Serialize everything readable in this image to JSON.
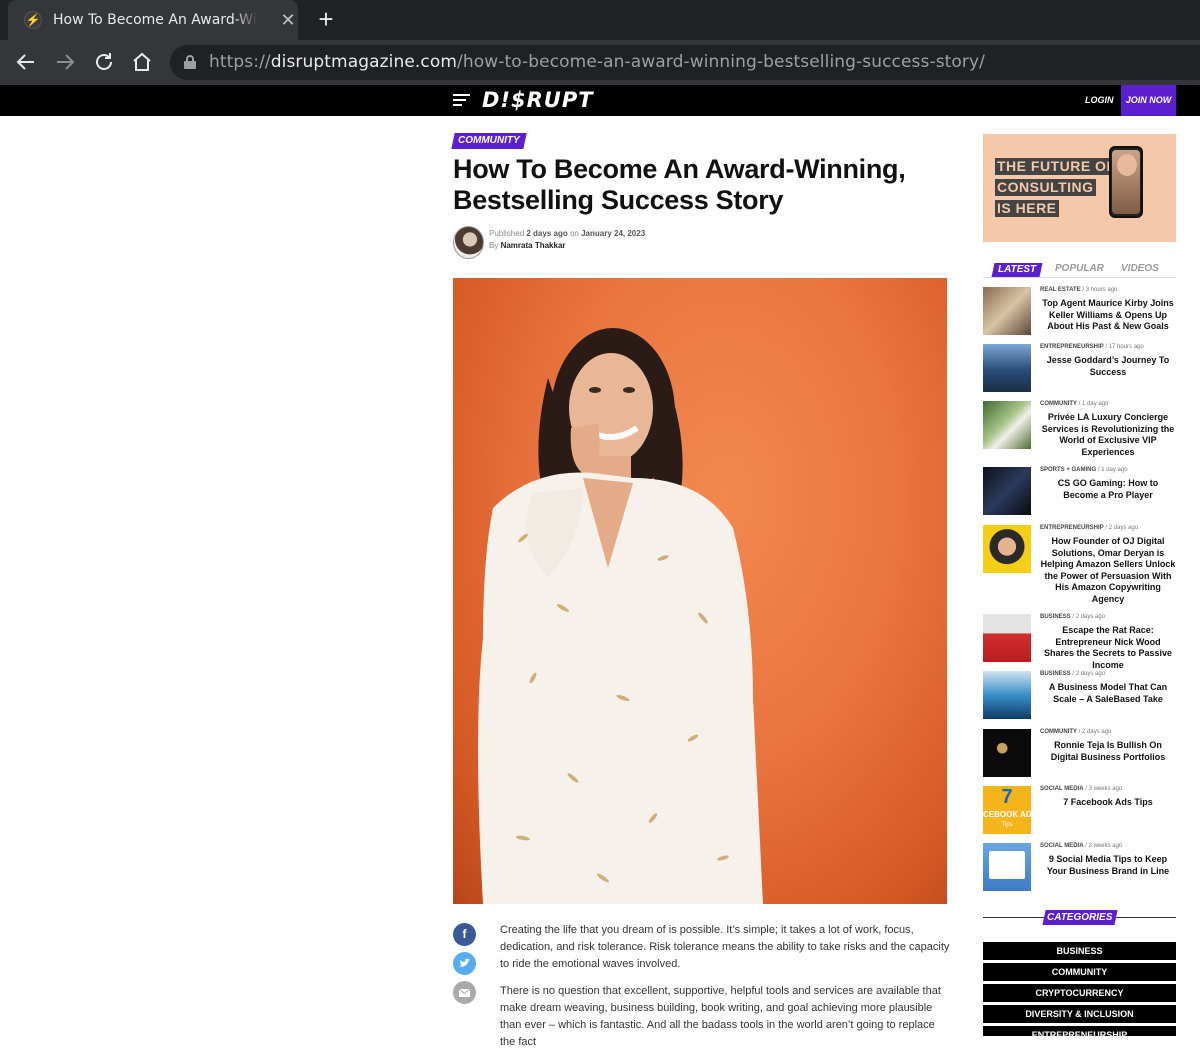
{
  "browser": {
    "tab_title": "How To Become An Award-Winning, Bestselling Success Story",
    "url_scheme": "https://",
    "url_host": "disruptmagazine.com",
    "url_path": "/how-to-become-an-award-winning-bestselling-success-story/"
  },
  "site": {
    "logo": "D!$RUPT",
    "login": "LOGIN",
    "join": "JOIN NOW"
  },
  "article": {
    "category": "COMMUNITY",
    "title_line1": "How To Become An Award-Winning,",
    "title_line2": "Bestselling Success Story",
    "published_label": "Published",
    "published_ago": "2 days ago",
    "published_on": "on",
    "published_date": "January 24, 2023",
    "by_label": "By",
    "author": "Namrata Thakkar",
    "para1": "Creating the life that you dream of is possible. It’s simple; it takes a lot of work, focus, dedication, and risk tolerance. Risk tolerance means the ability to take risks and the capacity to ride the emotional waves involved.",
    "para2": "There is no question that excellent, supportive, helpful tools and services are available that make dream weaving, business building, book writing, and goal achieving more plausible than ever – which is fantastic. And all the badass tools in the world aren’t going to replace the fact"
  },
  "ad": {
    "line1": "THE FUTURE OF",
    "line2": "CONSULTING",
    "line3": "IS HERE"
  },
  "sidebar": {
    "tabs": [
      "LATEST",
      "POPULAR",
      "VIDEOS"
    ],
    "feed": [
      {
        "category": "REAL ESTATE",
        "time": "3 hours ago",
        "title": "Top Agent Maurice Kirby Joins Keller Williams & Opens Up About His Past & New Goals"
      },
      {
        "category": "ENTREPRENEURSHIP",
        "time": "17 hours ago",
        "title": "Jesse Goddard’s Journey To Success"
      },
      {
        "category": "COMMUNITY",
        "time": "1 day ago",
        "title": "Privée LA Luxury Concierge Services is Revolutionizing the World of Exclusive VIP Experiences"
      },
      {
        "category": "SPORTS + GAMING",
        "time": "1 day ago",
        "title": "CS GO Gaming: How to Become a Pro Player"
      },
      {
        "category": "ENTREPRENEURSHIP",
        "time": "2 days ago",
        "title": "How Founder of OJ Digital Solutions, Omar Deryan is Helping Amazon Sellers Unlock the Power of Persuasion With His Amazon Copywriting Agency"
      },
      {
        "category": "BUSINESS",
        "time": "2 days ago",
        "title": "Escape the Rat Race: Entrepreneur Nick Wood Shares the Secrets to Passive Income"
      },
      {
        "category": "BUSINESS",
        "time": "2 days ago",
        "title": "A Business Model That Can Scale – A SaleBased Take"
      },
      {
        "category": "COMMUNITY",
        "time": "2 days ago",
        "title": "Ronnie Teja Is Bullish On Digital Business Portfolios"
      },
      {
        "category": "SOCIAL MEDIA",
        "time": "3 weeks ago",
        "title": "7 Facebook Ads Tips"
      },
      {
        "category": "SOCIAL MEDIA",
        "time": "3 weeks ago",
        "title": "9 Social Media Tips to Keep Your Business Brand in Line"
      }
    ],
    "thumb_text_7": "7",
    "thumb_text_ad": "CEBOOK AD",
    "thumb_text_tips": "Tips",
    "categories_head": "CATEGORIES",
    "categories": [
      "BUSINESS",
      "COMMUNITY",
      "CRYPTOCURRENCY",
      "DIVERSITY & INCLUSION",
      "ENTREPRENEURSHIP"
    ]
  },
  "colors": {
    "brand_purple": "#5b1fd1",
    "hero_orange": "#ea7540"
  }
}
